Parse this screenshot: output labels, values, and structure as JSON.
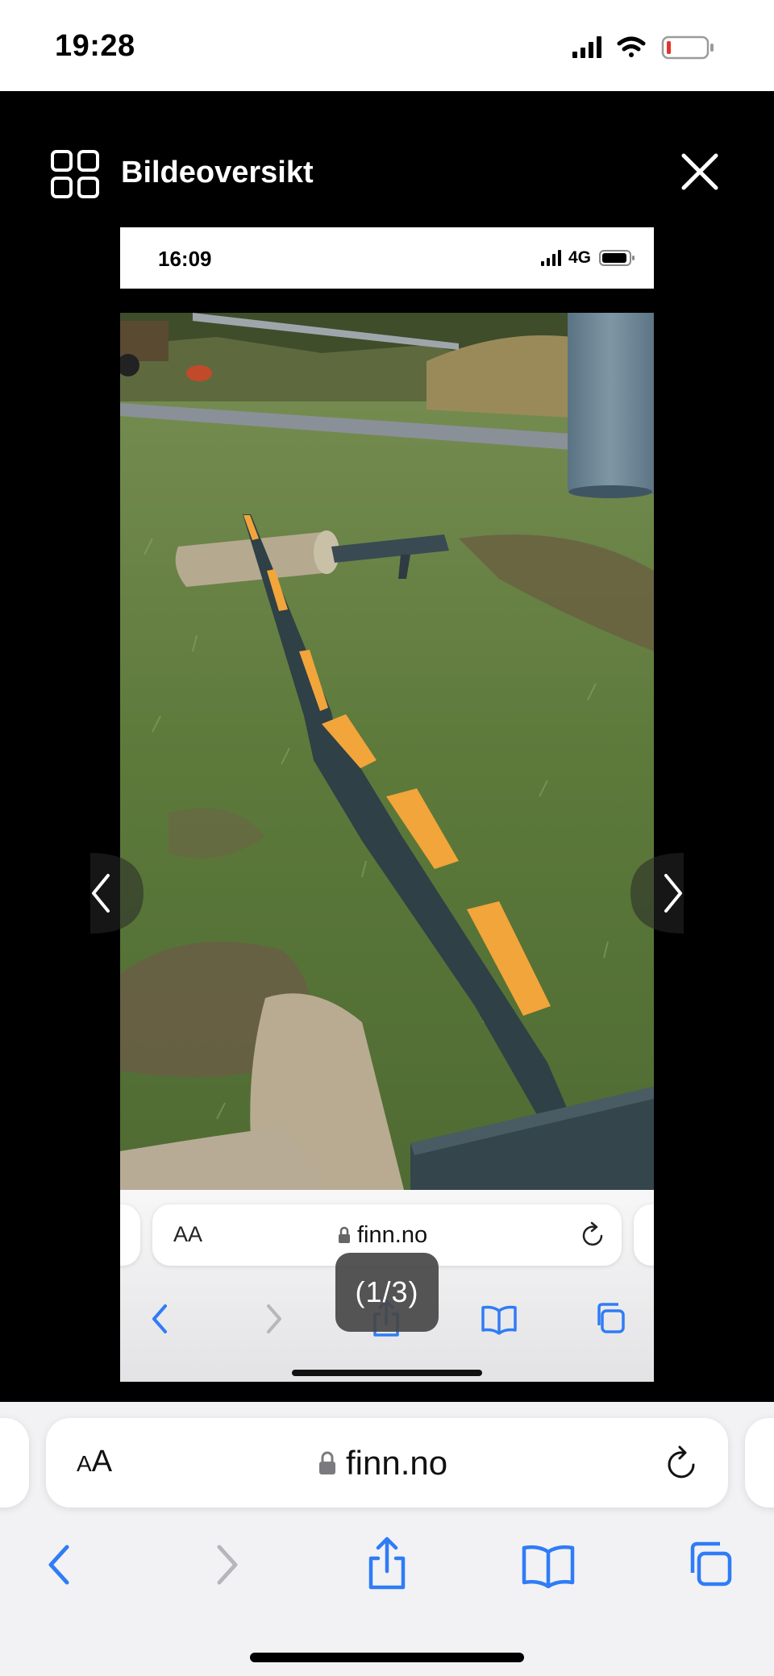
{
  "status_bar": {
    "time": "19:28"
  },
  "viewer": {
    "title": "Bildeoversikt",
    "counter": "(1/3)",
    "header_icons": [
      "grid-icon",
      "close-icon"
    ],
    "nav_icons": [
      "chevron-left-icon",
      "chevron-right-icon"
    ]
  },
  "inner_screenshot": {
    "time": "16:09",
    "network": "4G",
    "url_bar": {
      "text_size_label": "AA",
      "domain": "finn.no"
    }
  },
  "browser": {
    "url_bar": {
      "text_size_label_small": "A",
      "text_size_label_large": "A",
      "domain": "finn.no"
    },
    "toolbar_icons": [
      "back-icon",
      "forward-icon",
      "share-icon",
      "bookmarks-icon",
      "tabs-icon"
    ],
    "colors": {
      "accent": "#2f7cf6",
      "disabled": "#b6b6bb"
    }
  }
}
